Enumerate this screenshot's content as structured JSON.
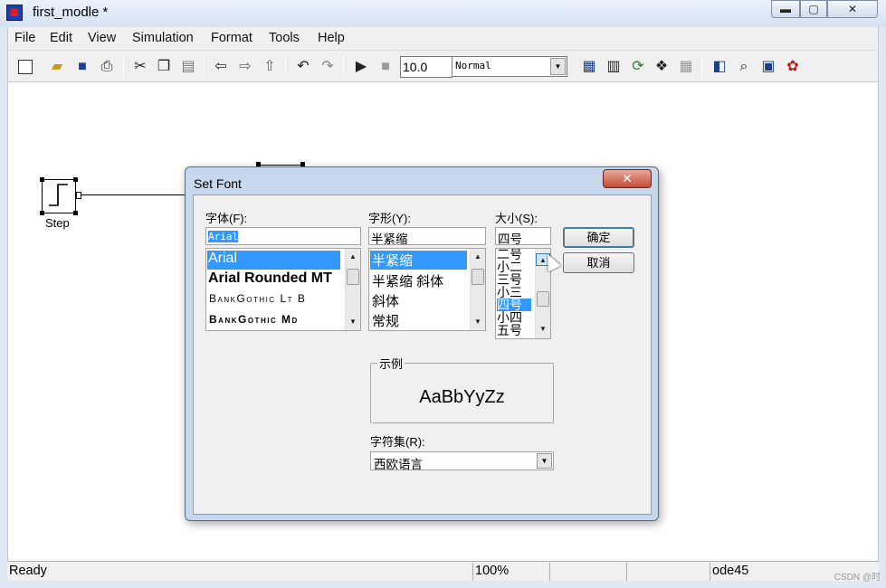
{
  "window": {
    "title": "first_modle *",
    "minimize": "▬",
    "maximize": "▢",
    "close": "✕"
  },
  "menu": [
    "File",
    "Edit",
    "View",
    "Simulation",
    "Format",
    "Tools",
    "Help"
  ],
  "toolbar": {
    "stop_time": "10.0",
    "sim_mode": "Normal"
  },
  "canvas": {
    "step_label": "Step"
  },
  "status": {
    "ready": "Ready",
    "zoom": "100%",
    "solver": "ode45",
    "watermark": "CSDN @时"
  },
  "dialog": {
    "title": "Set Font",
    "close_label": "✕",
    "font_label": "字体(F):",
    "font_value": "Arial",
    "fonts": [
      "Arial",
      "Arial Rounded MT",
      "BankGothic Lt B",
      "BankGothic Md"
    ],
    "style_label": "字形(Y):",
    "style_value": "半紧缩",
    "styles": [
      "半紧缩",
      "半紧缩 斜体",
      "斜体",
      "常规"
    ],
    "size_label": "大小(S):",
    "size_value": "四号",
    "sizes": [
      "二号",
      "小二",
      "三号",
      "小三",
      "四号",
      "小四",
      "五号"
    ],
    "ok_label": "确定",
    "cancel_label": "取消",
    "sample_label": "示例",
    "sample_text": "AaBbYyZz",
    "charset_label": "字符集(R):",
    "charset_value": "西欧语言"
  }
}
